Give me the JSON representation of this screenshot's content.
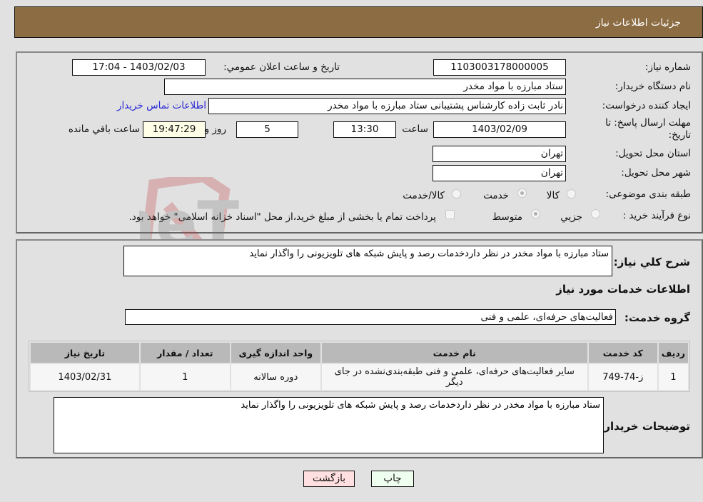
{
  "header": {
    "title": "جزئیات اطلاعات نیاز"
  },
  "form": {
    "need_number": {
      "label": "شماره نیاز:",
      "value": "1103003178000005"
    },
    "announce_datetime": {
      "label": "تاریخ و ساعت اعلان عمومي:",
      "value": "1403/02/03 - 17:04"
    },
    "buyer_org": {
      "label": "نام دستگاه خریدار:",
      "value": "ستاد مبارزه با مواد مخدر"
    },
    "requester": {
      "label": "ایجاد کننده درخواست:",
      "value": "نادر ثابت زاده کارشناس پشتیبانی ستاد مبارزه با مواد مخدر"
    },
    "buyer_contact_link": "اطلاعات تماس خریدار",
    "deadline": {
      "label": "مهلت ارسال پاسخ: تا تاریخ:",
      "date": "1403/02/09",
      "time_label": "ساعت",
      "time": "13:30",
      "days": "5",
      "days_label": "روز و",
      "remaining": "19:47:29",
      "remaining_label": "ساعت باقي مانده"
    },
    "province": {
      "label": "استان محل تحویل:",
      "value": "تهران"
    },
    "city": {
      "label": "شهر محل تحویل:",
      "value": "تهران"
    },
    "category": {
      "label": "طبقه بندی موضوعی:",
      "options": [
        "کالا",
        "خدمت",
        "کالا/خدمت"
      ],
      "selected": "خدمت"
    },
    "purchase_type": {
      "label": "نوع فرآیند خرید :",
      "options": [
        "جزیي",
        "متوسط"
      ],
      "selected": "متوسط",
      "treasury_note": "پرداخت تمام یا بخشی از مبلغ خرید،از محل \"اسناد خزانه اسلامی\" خواهد بود."
    }
  },
  "details": {
    "general_desc_label": "شرح کلي نیاز:",
    "general_desc": "ستاد مبارزه با مواد مخدر در نظر داردخدمات رصد و پایش شبکه های تلویزیونی را واگذار نماید",
    "services_heading": "اطلاعات خدمات مورد نیاز",
    "service_group_label": "گروه خدمت:",
    "service_group": "فعالیت‌های حرفه‌ای، علمی و فنی",
    "table": {
      "headers": [
        "ردیف",
        "کد خدمت",
        "نام خدمت",
        "واحد اندازه گیری",
        "تعداد / مقدار",
        "تاریخ نیاز"
      ],
      "rows": [
        [
          "1",
          "ز-74-749",
          "سایر فعالیت‌های حرفه‌ای، علمی و فنی طبقه‌بندی‌نشده در جای دیگر",
          "دوره سالانه",
          "1",
          "1403/02/31"
        ]
      ]
    },
    "buyer_notes_label": "توضیحات خریدار:",
    "buyer_notes": "ستاد مبارزه با مواد مخدر در نظر داردخدمات رصد و پایش شبکه های تلویزیونی را واگذار نماید"
  },
  "buttons": {
    "print": "چاپ",
    "back": "بازگشت"
  },
  "watermark": {
    "text": "AriaTender.neT"
  },
  "colors": {
    "header": "#8b6c43",
    "link": "#2b2bd6",
    "print_bg": "#efffef",
    "back_bg": "#ffdfdf"
  }
}
